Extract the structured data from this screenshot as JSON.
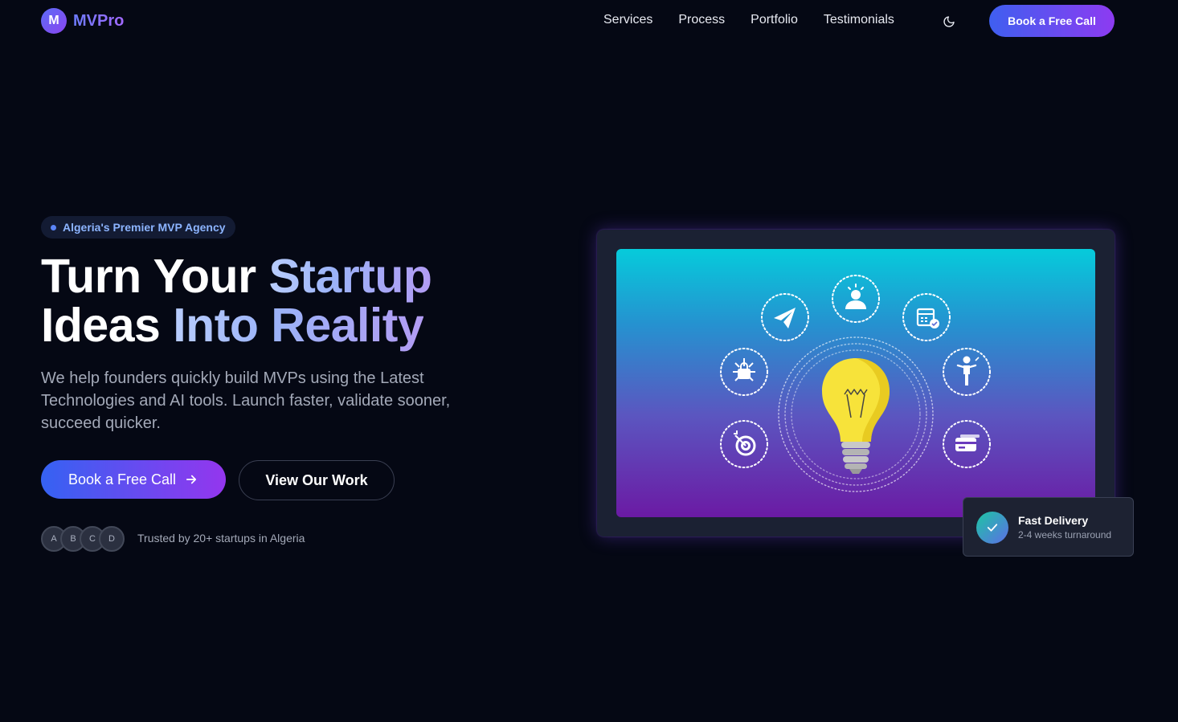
{
  "brand": {
    "initial": "M",
    "name": "MVPro"
  },
  "nav": {
    "links": [
      "Services",
      "Process",
      "Portfolio",
      "Testimonials"
    ],
    "theme_icon": "moon-icon",
    "cta_label": "Book a Free Call"
  },
  "hero": {
    "badge": "Algeria's Premier MVP Agency",
    "headline": {
      "line1_plain": "Turn Your ",
      "line1_accent": "Startup",
      "line2_plain": "Ideas ",
      "line2_accent": "Into Reality"
    },
    "subtext": "We help founders quickly build MVPs using the Latest Technologies and AI tools. Launch faster, validate sooner, succeed quicker.",
    "primary_button": "Book a Free Call",
    "primary_button_icon": "arrow-right-icon",
    "secondary_button": "View Our Work",
    "avatars": [
      "A",
      "B",
      "C",
      "D"
    ],
    "trusted_text": "Trusted by 20+ startups in Algeria"
  },
  "illustration": {
    "center_icon": "lightbulb-icon",
    "orbit_icons": [
      "paper-plane-icon",
      "idea-person-icon",
      "calendar-check-icon",
      "network-lock-icon",
      "presenter-icon",
      "target-icon",
      "credit-card-icon"
    ]
  },
  "delivery_card": {
    "icon": "check-icon",
    "title": "Fast Delivery",
    "subtitle": "2-4 weeks turnaround"
  },
  "colors": {
    "background": "#050814",
    "accent_blue": "#3562f2",
    "accent_purple": "#9436ee",
    "badge_text": "#8cb4ff"
  }
}
